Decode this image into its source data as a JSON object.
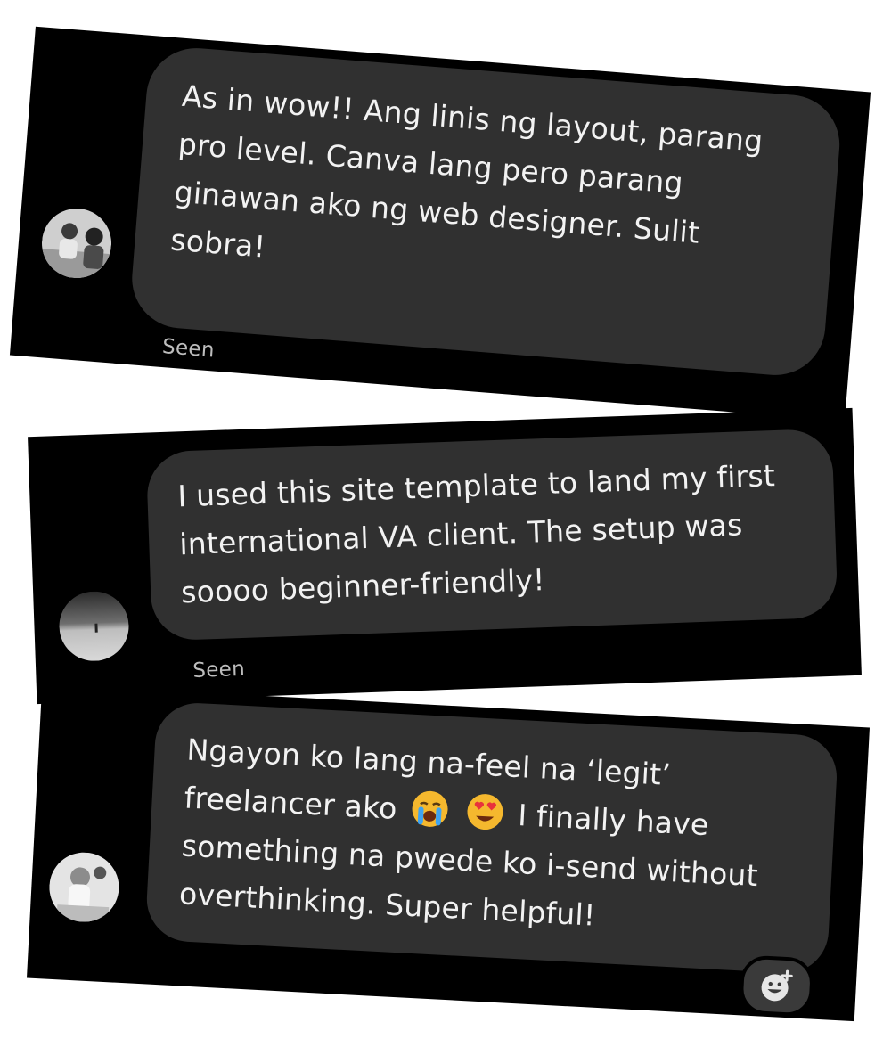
{
  "messages": [
    {
      "lines": [
        "As in wow!! Ang linis ng layout, parang",
        "pro level. Canva lang pero parang",
        "ginawan ako ng web designer. Sulit",
        "sobra!"
      ],
      "status": "Seen",
      "avatar": "avatar-photo-people"
    },
    {
      "lines": [
        "I used this site template to land my first",
        "international VA client. The setup was",
        "soooo beginner-friendly!"
      ],
      "status": "Seen",
      "avatar": "avatar-photo-landscape"
    },
    {
      "lines": [
        "Ngayon ko lang na-feel na ‘legit’",
        "freelancer ako",
        "I finally have",
        "something na pwede ko i-send without",
        "overthinking. Super helpful!"
      ],
      "emojis": [
        "loudly-crying-face-icon",
        "heart-eyes-face-icon"
      ],
      "avatar": "avatar-photo-person"
    }
  ],
  "reaction_button": {
    "icon": "add-reaction-icon"
  },
  "colors": {
    "card_background": "#000000",
    "bubble_background": "#303030",
    "text": "#f2f2f2",
    "seen_text": "#bdbdbd"
  }
}
